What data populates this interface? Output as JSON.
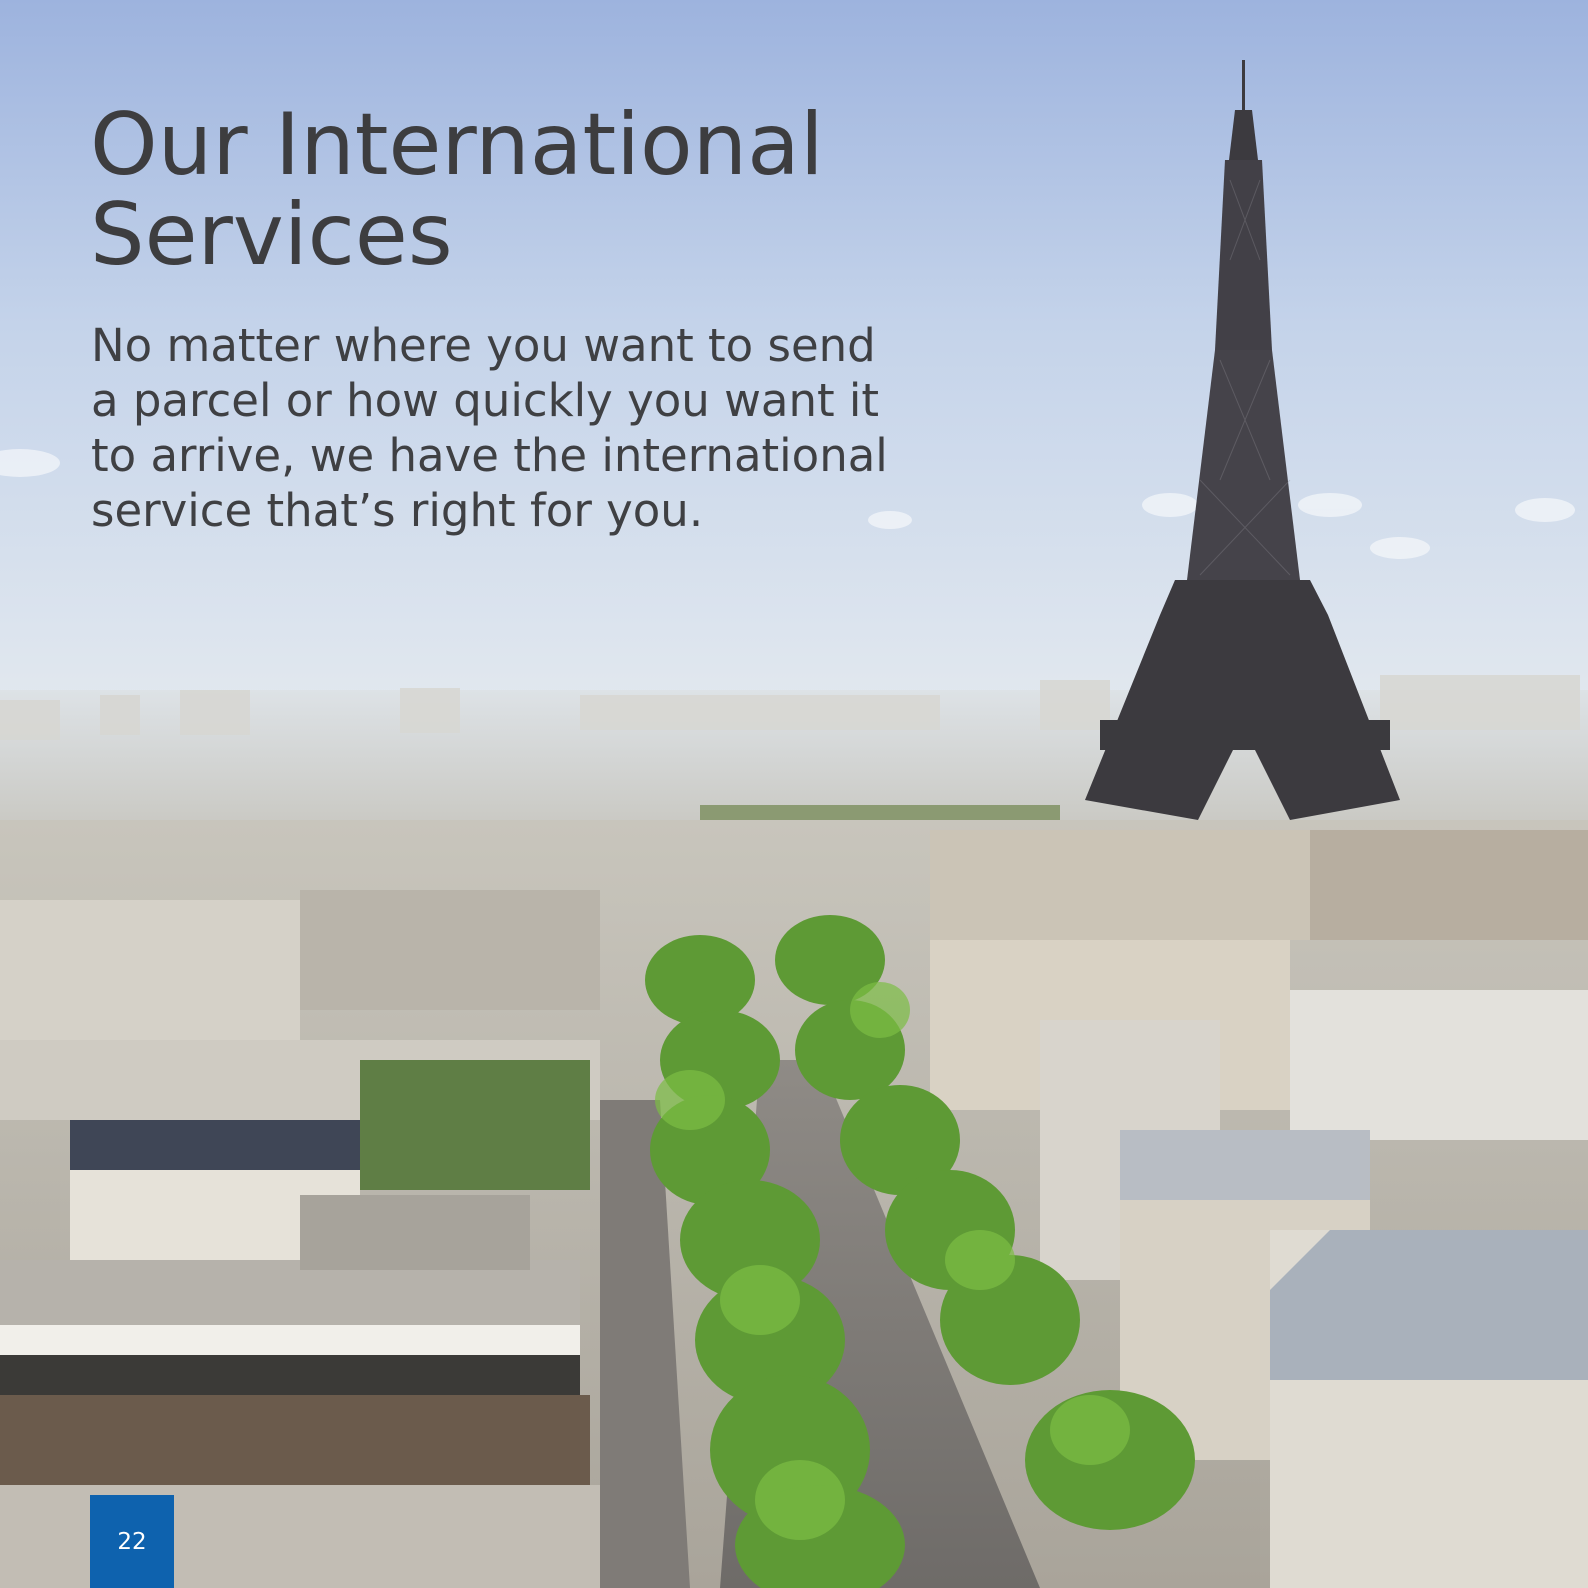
{
  "heading": {
    "line1": "Our International",
    "line2": "Services"
  },
  "intro": {
    "line1": "No matter where you want to send",
    "line2": "a parcel or how quickly you want it",
    "line3": "to arrive, we have the international",
    "line4": "service that’s right for you."
  },
  "page_number": "22",
  "colors": {
    "page_badge": "#0e62ae",
    "heading_text": "#3d3d3f",
    "sky_top": "#9db3de",
    "sky_bottom": "#dce6f0"
  },
  "image": {
    "subject": "paris-skyline-eiffel-tower-photo"
  }
}
